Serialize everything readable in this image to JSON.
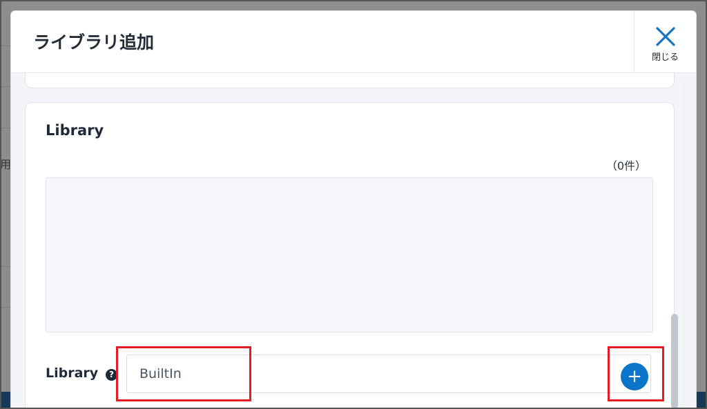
{
  "background": {
    "partial_char": "用"
  },
  "modal": {
    "title": "ライブラリ追加",
    "close_label": "閉じる",
    "close_icon": "close-icon",
    "library_section": {
      "title": "Library",
      "count": "（0件）",
      "items": [],
      "input_label": "Library",
      "input_value": "BuiltIn",
      "help_icon": "?",
      "add_icon": "+"
    }
  },
  "colors": {
    "accent": "#0b75c9",
    "highlight": "#e51b23",
    "title_text": "#222b36"
  }
}
